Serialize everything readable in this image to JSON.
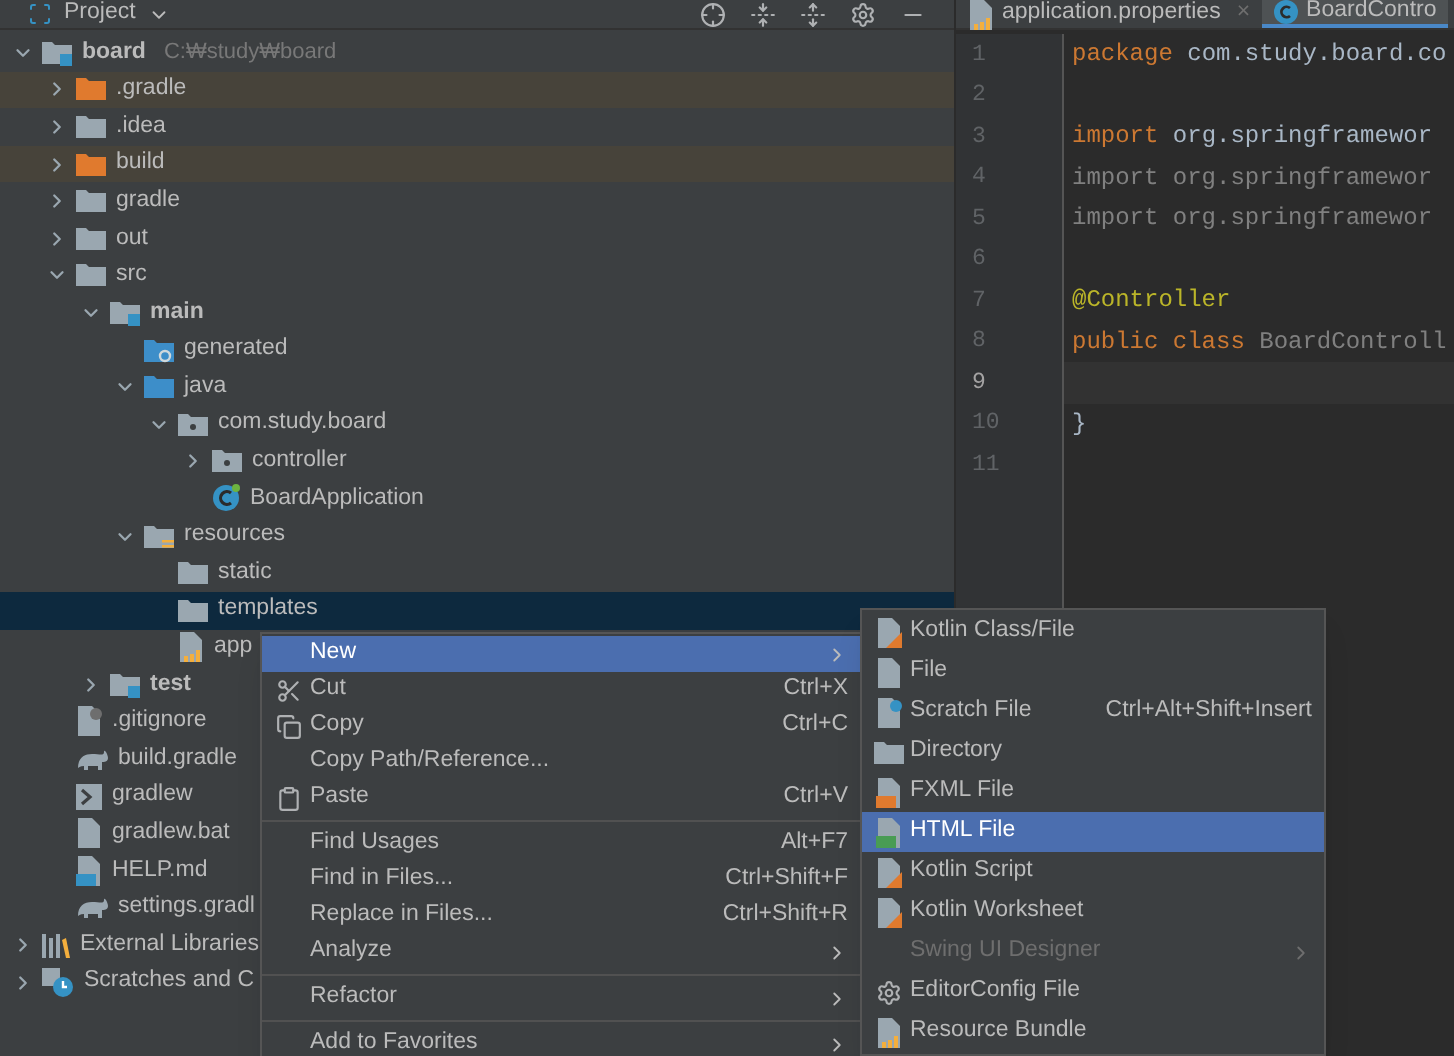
{
  "project_panel": {
    "title": "Project"
  },
  "tree": [
    {
      "label": "board",
      "path": "C:₩study₩board",
      "kind": "module",
      "expanded": true,
      "selected": false,
      "children": [
        {
          "label": ".gradle",
          "kind": "folder",
          "excluded": true,
          "expanded": false,
          "selected": false
        },
        {
          "label": ".idea",
          "kind": "folder",
          "excluded": false,
          "expanded": false,
          "selected": false
        },
        {
          "label": "build",
          "kind": "folder",
          "excluded": true,
          "expanded": false,
          "selected": false
        },
        {
          "label": "gradle",
          "kind": "folder",
          "excluded": false,
          "expanded": false,
          "selected": false
        },
        {
          "label": "out",
          "kind": "folder",
          "excluded": false,
          "expanded": false,
          "selected": false
        },
        {
          "label": "src",
          "kind": "folder",
          "excluded": false,
          "expanded": true,
          "selected": false,
          "children": [
            {
              "label": "main",
              "kind": "source-set",
              "expanded": true,
              "selected": false,
              "children": [
                {
                  "label": "generated",
                  "kind": "generated",
                  "selected": false
                },
                {
                  "label": "java",
                  "kind": "source-root",
                  "expanded": true,
                  "selected": false,
                  "children": [
                    {
                      "label": "com.study.board",
                      "kind": "package",
                      "expanded": true,
                      "selected": false,
                      "children": [
                        {
                          "label": "controller",
                          "kind": "package",
                          "expanded": false,
                          "selected": false
                        },
                        {
                          "label": "BoardApplication",
                          "kind": "spring-class",
                          "selected": false
                        }
                      ]
                    }
                  ]
                },
                {
                  "label": "resources",
                  "kind": "resources-root",
                  "expanded": true,
                  "selected": false,
                  "children": [
                    {
                      "label": "static",
                      "kind": "folder",
                      "excluded": false,
                      "selected": false
                    },
                    {
                      "label": "templates",
                      "kind": "folder",
                      "excluded": false,
                      "selected": true
                    },
                    {
                      "label": "app",
                      "kind": "properties",
                      "selected": false
                    }
                  ]
                }
              ]
            },
            {
              "label": "test",
              "kind": "source-set",
              "expanded": false,
              "selected": false
            }
          ]
        },
        {
          "label": ".gitignore",
          "kind": "ignore",
          "selected": false
        },
        {
          "label": "build.gradle",
          "kind": "gradle",
          "selected": false
        },
        {
          "label": "gradlew",
          "kind": "script",
          "selected": false
        },
        {
          "label": "gradlew.bat",
          "kind": "text",
          "selected": false
        },
        {
          "label": "HELP.md",
          "kind": "markdown",
          "selected": false
        },
        {
          "label": "settings.gradl",
          "kind": "gradle",
          "selected": false
        }
      ]
    },
    {
      "label": "External Libraries",
      "kind": "libraries",
      "expanded": false,
      "selected": false
    },
    {
      "label": "Scratches and C",
      "kind": "scratches",
      "expanded": false,
      "selected": false
    }
  ],
  "editor": {
    "tabs": [
      {
        "label": "application.properties",
        "kind": "properties",
        "close": "×",
        "selected": false
      },
      {
        "label": "BoardContro",
        "kind": "class",
        "selected": true
      }
    ],
    "lines": [
      {
        "number": "1",
        "current": false,
        "tokens": [
          {
            "kind": "keyword",
            "text": "package"
          },
          {
            "kind": "plain",
            "text": " com.study.board.co"
          }
        ]
      },
      {
        "number": "2",
        "current": false
      },
      {
        "number": "3",
        "current": false,
        "tokens": [
          {
            "kind": "keyword",
            "text": "import"
          },
          {
            "kind": "plain",
            "text": " org.springframewor"
          }
        ]
      },
      {
        "number": "4",
        "current": false,
        "tokens": [
          {
            "kind": "unused",
            "text": "import org.springframewor"
          }
        ]
      },
      {
        "number": "5",
        "current": false,
        "tokens": [
          {
            "kind": "unused",
            "text": "import org.springframewor"
          }
        ]
      },
      {
        "number": "6",
        "current": false
      },
      {
        "number": "7",
        "current": false,
        "tokens": [
          {
            "kind": "annotation",
            "text": "@Controller"
          }
        ]
      },
      {
        "number": "8",
        "current": false,
        "tokens": [
          {
            "kind": "keyword",
            "text": "public class"
          },
          {
            "kind": "unused",
            "text": " BoardControll"
          }
        ]
      },
      {
        "number": "9",
        "current": true
      },
      {
        "number": "10",
        "current": false,
        "tokens": [
          {
            "kind": "plain",
            "text": "}"
          }
        ]
      },
      {
        "number": "11",
        "current": false
      }
    ]
  },
  "context_menu": [
    {
      "kind": "submenu",
      "label": "New",
      "selected": true
    },
    {
      "kind": "item",
      "label": "Cut",
      "shortcut": "Ctrl+X",
      "selected": false
    },
    {
      "kind": "item",
      "label": "Copy",
      "shortcut": "Ctrl+C",
      "selected": false
    },
    {
      "kind": "item",
      "label": "Copy Path/Reference...",
      "selected": false
    },
    {
      "kind": "item",
      "label": "Paste",
      "shortcut": "Ctrl+V",
      "selected": false
    },
    {
      "kind": "separator"
    },
    {
      "kind": "item",
      "label": "Find Usages",
      "shortcut": "Alt+F7",
      "selected": false
    },
    {
      "kind": "item",
      "label": "Find in Files...",
      "shortcut": "Ctrl+Shift+F",
      "selected": false
    },
    {
      "kind": "item",
      "label": "Replace in Files...",
      "shortcut": "Ctrl+Shift+R",
      "selected": false
    },
    {
      "kind": "submenu",
      "label": "Analyze",
      "selected": false
    },
    {
      "kind": "separator"
    },
    {
      "kind": "submenu",
      "label": "Refactor",
      "selected": false
    },
    {
      "kind": "separator"
    },
    {
      "kind": "submenu",
      "label": "Add to Favorites",
      "selected": false
    }
  ],
  "new_submenu": [
    {
      "kind": "item",
      "label": "Kotlin Class/File",
      "selected": false,
      "disabled": false
    },
    {
      "kind": "item",
      "label": "File",
      "selected": false,
      "disabled": false
    },
    {
      "kind": "item",
      "label": "Scratch File",
      "shortcut": "Ctrl+Alt+Shift+Insert",
      "selected": false,
      "disabled": false
    },
    {
      "kind": "item",
      "label": "Directory",
      "selected": false,
      "disabled": false
    },
    {
      "kind": "item",
      "label": "FXML File",
      "selected": false,
      "disabled": false
    },
    {
      "kind": "item",
      "label": "HTML File",
      "selected": true,
      "disabled": false
    },
    {
      "kind": "item",
      "label": "Kotlin Script",
      "selected": false,
      "disabled": false
    },
    {
      "kind": "item",
      "label": "Kotlin Worksheet",
      "selected": false,
      "disabled": false
    },
    {
      "kind": "submenu",
      "label": "Swing UI Designer",
      "selected": false,
      "disabled": true
    },
    {
      "kind": "item",
      "label": "EditorConfig File",
      "selected": false,
      "disabled": false
    },
    {
      "kind": "item",
      "label": "Resource Bundle",
      "selected": false,
      "disabled": false
    }
  ]
}
